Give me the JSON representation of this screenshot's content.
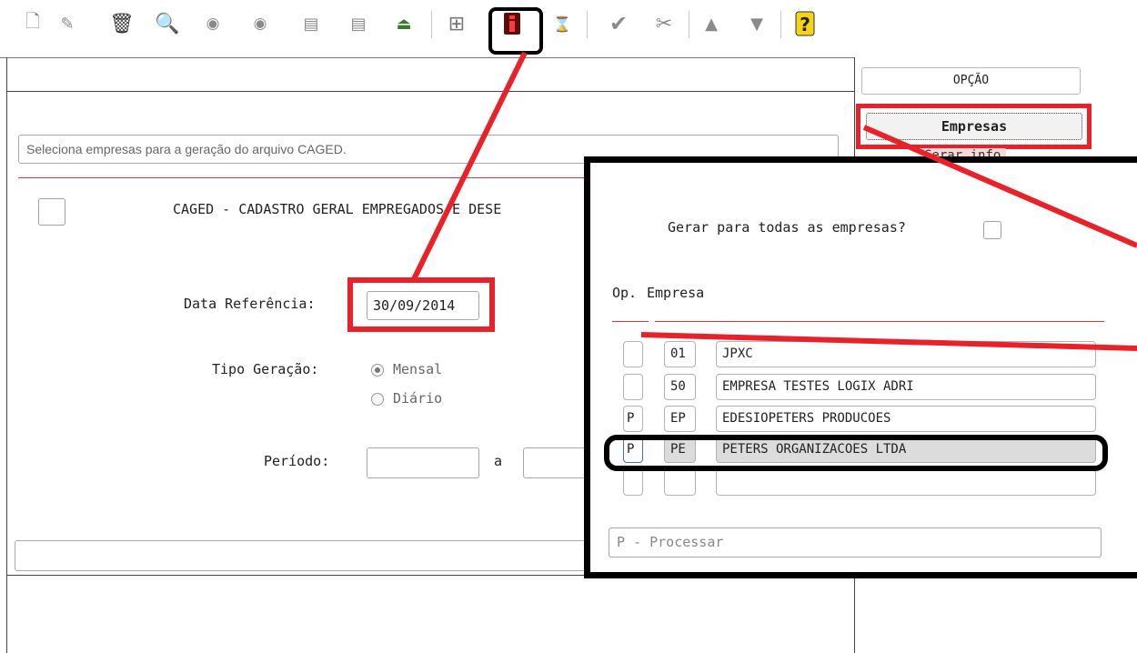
{
  "toolbar": {
    "icons": [
      "new-document-icon",
      "edit-icon",
      "trash-icon",
      "search-icon",
      "previous-icon",
      "next-icon",
      "print-icon",
      "print-preview-icon",
      "exit-icon",
      "binoculars-icon",
      "info-icon",
      "hourglass-icon",
      "check-icon",
      "tools-icon",
      "up-icon",
      "filter-icon",
      "help-icon"
    ]
  },
  "form": {
    "hint": "Seleciona empresas para a geração do arquivo CAGED.",
    "title": "CAGED - CADASTRO GERAL EMPREGADOS E DESE",
    "data_ref_label": "Data Referência:",
    "data_ref_value": "30/09/2014",
    "tipo_label": "Tipo Geração:",
    "opt_mensal": "Mensal",
    "opt_diario": "Diário",
    "periodo_label": "Período:",
    "periodo_sep": "a"
  },
  "side": {
    "opcao": "OPÇÃO",
    "empresas": "Empresas",
    "gerar_info": "Gerar info"
  },
  "popup": {
    "question": "Gerar para todas as empresas?",
    "col_op": "Op.",
    "col_empresa": "Empresa",
    "rows": [
      {
        "op": "",
        "code": "01",
        "name": "JPXC"
      },
      {
        "op": "",
        "code": "50",
        "name": "EMPRESA TESTES LOGIX ADRI"
      },
      {
        "op": "P",
        "code": "EP",
        "name": "EDESIOPETERS PRODUCOES"
      },
      {
        "op": "P",
        "code": "PE",
        "name": "PETERS ORGANIZACOES LTDA"
      },
      {
        "op": "",
        "code": "",
        "name": ""
      }
    ],
    "footer": "P - Processar"
  },
  "colors": {
    "annotation_red": "#e8222a",
    "annotation_black": "#000000",
    "rule_red": "#d93838"
  }
}
